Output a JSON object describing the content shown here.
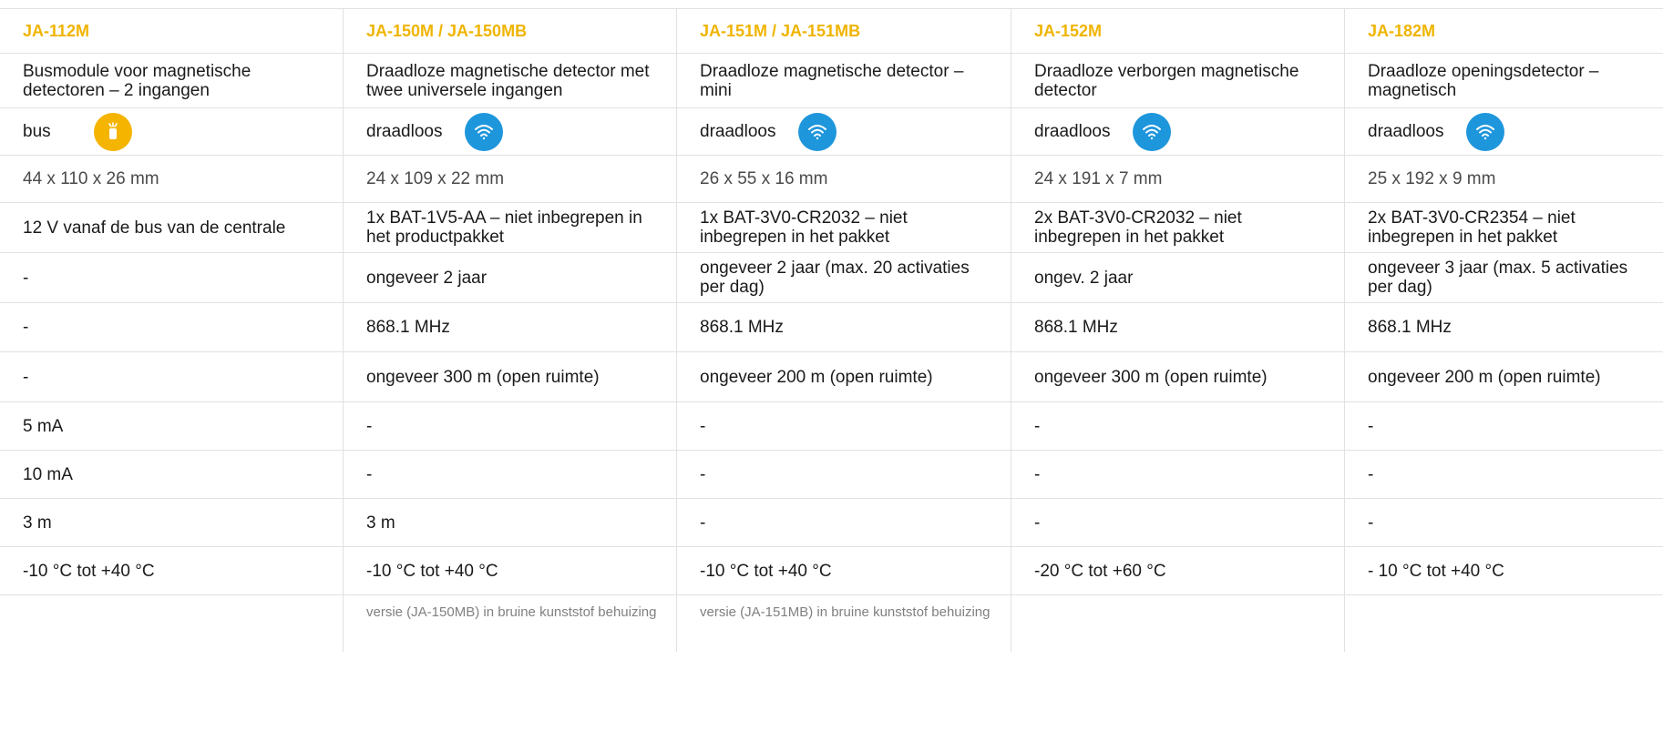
{
  "columns": [
    {
      "model": "JA-112M",
      "description": "Busmodule voor magnetische detectoren – 2 ingangen",
      "type": "bus",
      "type_icon": "bus-icon",
      "dimensions": "44 x 110 x 26 mm",
      "power": "12 V vanaf de bus van de centrale",
      "battery_life": "-",
      "frequency": "-",
      "range": "-",
      "current_standby": "5 mA",
      "current_max": "10 mA",
      "cable": "3 m",
      "temperature": "-10 °C tot +40 °C",
      "note": ""
    },
    {
      "model": "JA-150M / JA-150MB",
      "description": "Draadloze magnetische detector met twee universele ingangen",
      "type": "draadloos",
      "type_icon": "wifi-icon",
      "dimensions": "24 x 109 x 22 mm",
      "power": "1x BAT-1V5-AA – niet inbegrepen in het productpakket",
      "battery_life": "ongeveer 2 jaar",
      "frequency": "868.1 MHz",
      "range": "ongeveer 300 m (open ruimte)",
      "current_standby": "-",
      "current_max": "-",
      "cable": "3 m",
      "temperature": "-10 °C tot +40 °C",
      "note": "versie (JA-150MB) in bruine kunststof behuizing"
    },
    {
      "model": "JA-151M / JA-151MB",
      "description": "Draadloze magnetische detector – mini",
      "type": "draadloos",
      "type_icon": "wifi-icon",
      "dimensions": "26 x 55 x 16 mm",
      "power": "1x BAT-3V0-CR2032 – niet inbegrepen in het pakket",
      "battery_life": "ongeveer 2 jaar (max. 20 activaties per dag)",
      "frequency": "868.1 MHz",
      "range": "ongeveer 200 m (open ruimte)",
      "current_standby": "-",
      "current_max": "-",
      "cable": "-",
      "temperature": "-10 °C tot +40 °C",
      "note": "versie (JA-151MB) in bruine kunststof behuizing"
    },
    {
      "model": "JA-152M",
      "description": "Draadloze verborgen magnetische detector",
      "type": "draadloos",
      "type_icon": "wifi-icon",
      "dimensions": "24 x 191 x 7 mm",
      "power": "2x BAT-3V0-CR2032 – niet inbegrepen in het pakket",
      "battery_life": "ongev. 2 jaar",
      "frequency": "868.1 MHz",
      "range": "ongeveer 300 m (open ruimte)",
      "current_standby": "-",
      "current_max": "-",
      "cable": "-",
      "temperature": "-20 °C tot +60 °C",
      "note": ""
    },
    {
      "model": "JA-182M",
      "description": "Draadloze openingsdetector – magnetisch",
      "type": "draadloos",
      "type_icon": "wifi-icon",
      "dimensions": "25 x 192 x 9 mm",
      "power": "2x BAT-3V0-CR2354 – niet inbegrepen in het pakket",
      "battery_life": "ongeveer 3 jaar (max. 5 activaties per dag)",
      "frequency": "868.1 MHz",
      "range": "ongeveer 200 m (open ruimte)",
      "current_standby": "-",
      "current_max": "-",
      "cable": "-",
      "temperature": "- 10 °C tot +40 °C",
      "note": ""
    }
  ],
  "colors": {
    "model_heading": "#f0b400",
    "bus_icon_bg": "#f4b400",
    "wifi_icon_bg": "#1e96dc",
    "grid_line": "#e1e1e1"
  }
}
